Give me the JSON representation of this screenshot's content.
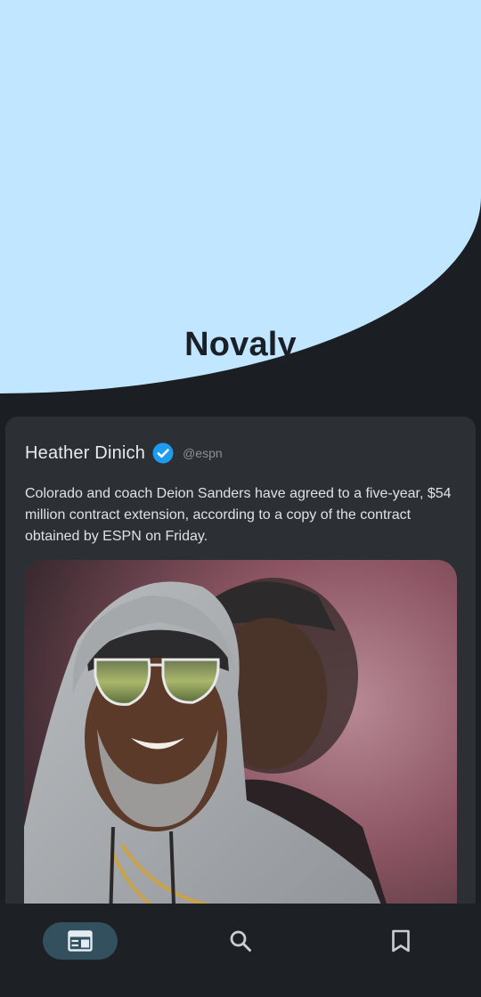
{
  "app": {
    "title": "Novaly"
  },
  "post": {
    "author_name": "Heather Dinich",
    "verified_icon": "verified-badge-icon",
    "handle": "@espn",
    "text": "Colorado and coach Deion Sanders have agreed to a five-year, $54 million contract extension, according to a copy of the contract obtained by ESPN on Friday.",
    "image_icon": "news-photo"
  },
  "bottom_nav": {
    "items": [
      {
        "icon": "news-feed-icon",
        "selected": true
      },
      {
        "icon": "search-icon",
        "selected": false
      },
      {
        "icon": "bookmark-icon",
        "selected": false
      }
    ]
  },
  "colors": {
    "hero_background": "#c1e6ff",
    "page_background": "#1b1f23",
    "card_background": "#2c3034",
    "verified_blue": "#1d9bf0",
    "nav_selected_pill": "#33505e"
  }
}
